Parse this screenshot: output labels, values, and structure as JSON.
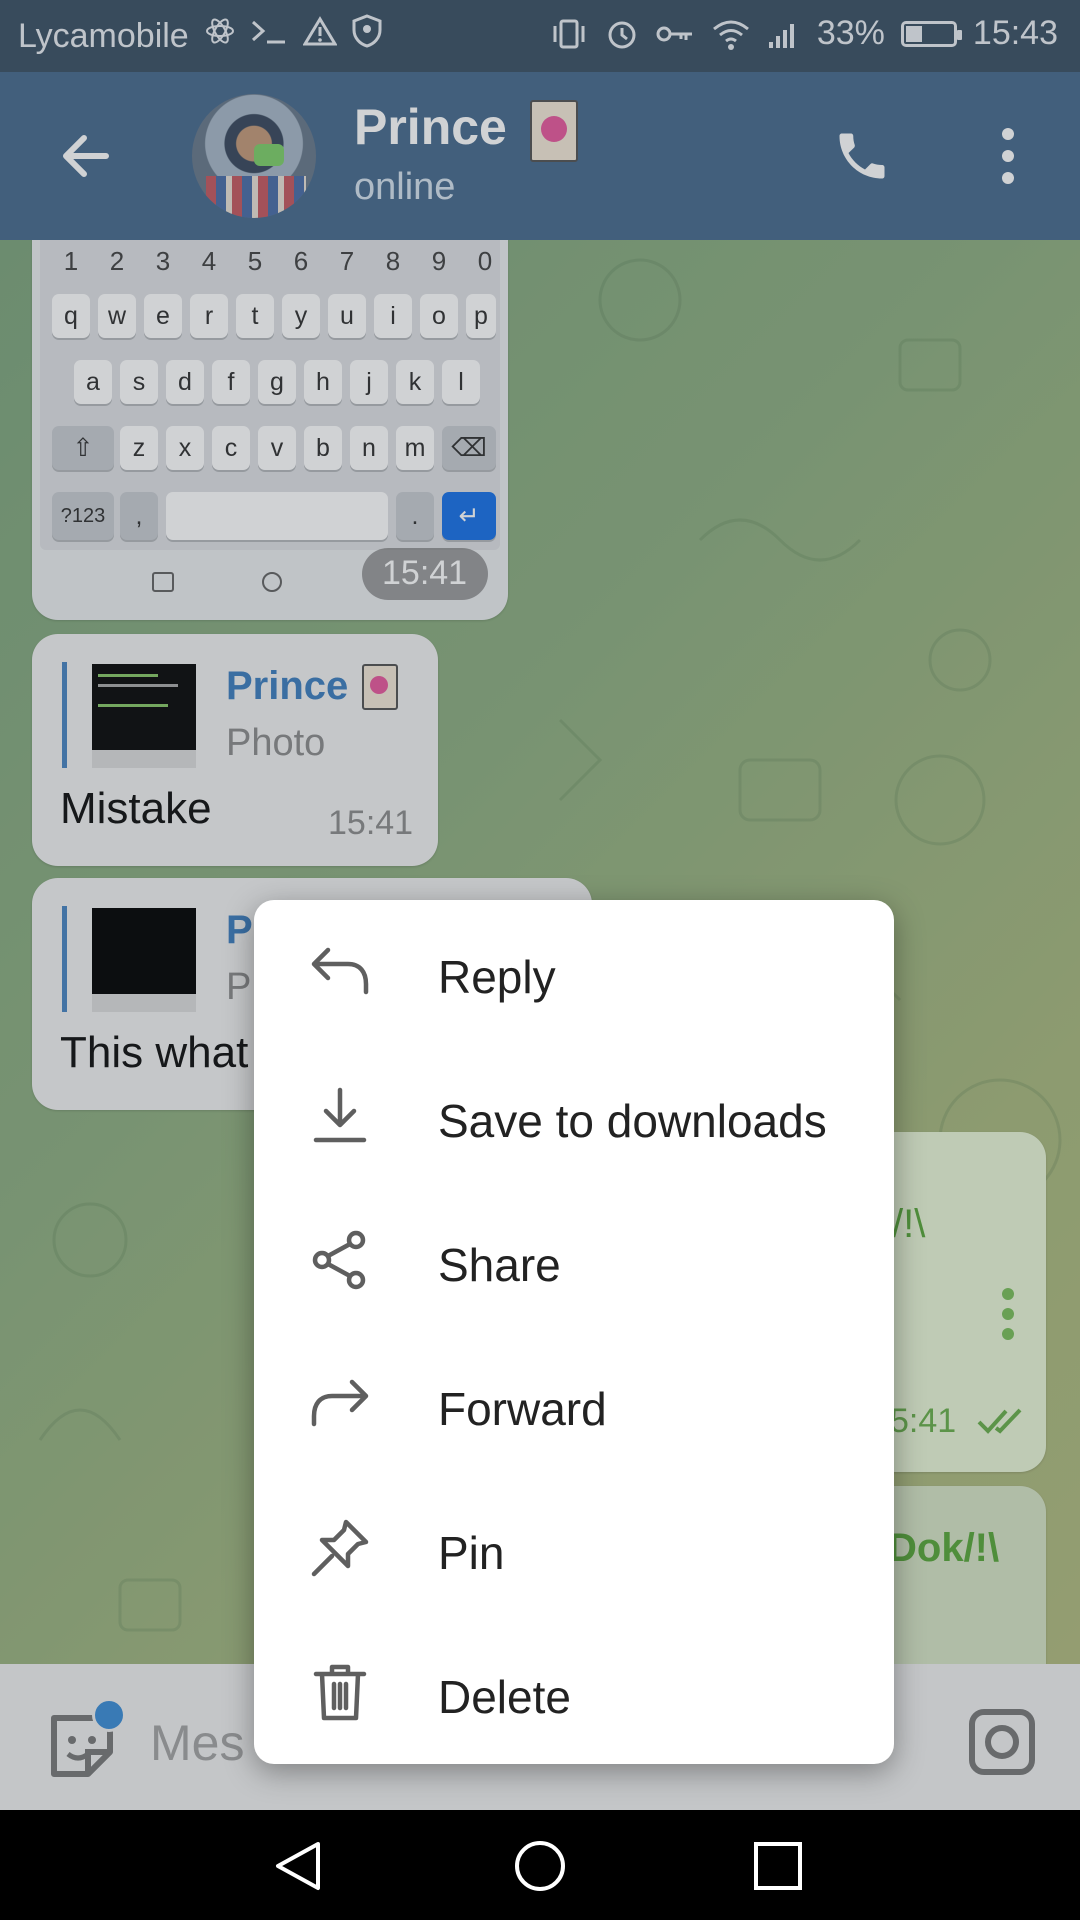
{
  "status_bar": {
    "carrier": "Lycamobile",
    "battery": "33%",
    "time": "15:43",
    "battery_level": 0.33
  },
  "header": {
    "name": "Prince",
    "status": "online"
  },
  "keyboard": {
    "numbers": [
      "1",
      "2",
      "3",
      "4",
      "5",
      "6",
      "7",
      "8",
      "9",
      "0"
    ],
    "row1": [
      "q",
      "w",
      "e",
      "r",
      "t",
      "y",
      "u",
      "i",
      "o",
      "p"
    ],
    "row2": [
      "a",
      "s",
      "d",
      "f",
      "g",
      "h",
      "j",
      "k",
      "l"
    ],
    "row3": [
      "z",
      "x",
      "c",
      "v",
      "b",
      "n",
      "m"
    ],
    "sym_key": "?123",
    "comma": ",",
    "period": "."
  },
  "messages": [
    {
      "time": "15:41"
    },
    {
      "reply_name": "Prince",
      "reply_type": "Photo",
      "text": "Mistake",
      "time": "15:41"
    },
    {
      "reply_name": "P",
      "reply_type": "P",
      "text": "This what"
    }
  ],
  "right_bubbles": {
    "b1_text": "/!\\",
    "b1_time": "5:41",
    "b2_text": "Dok/!\\"
  },
  "input": {
    "placeholder": "Mes"
  },
  "context_menu": {
    "items": [
      {
        "label": "Reply",
        "icon": "reply-icon"
      },
      {
        "label": "Save to downloads",
        "icon": "download-icon"
      },
      {
        "label": "Share",
        "icon": "share-icon"
      },
      {
        "label": "Forward",
        "icon": "forward-icon"
      },
      {
        "label": "Pin",
        "icon": "pin-icon"
      },
      {
        "label": "Delete",
        "icon": "trash-icon"
      }
    ]
  }
}
